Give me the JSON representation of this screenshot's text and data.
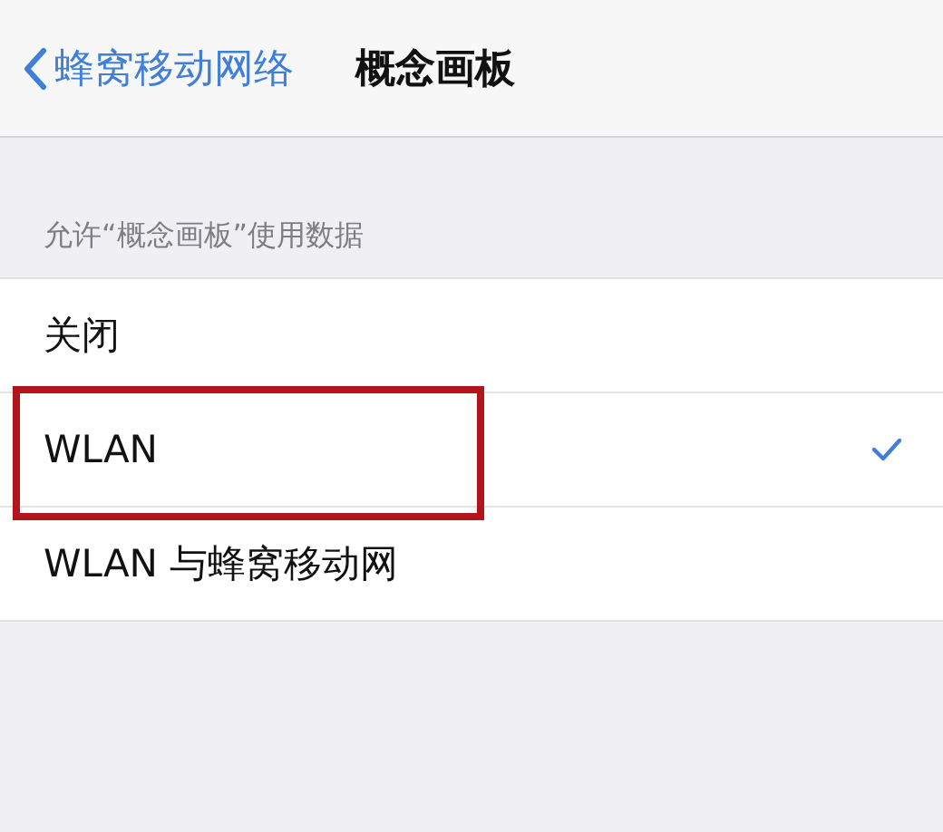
{
  "nav_bar": {
    "back_label": "蜂窝移动网络",
    "title": "概念画板"
  },
  "section": {
    "header": "允许“概念画板”使用数据",
    "options": [
      {
        "label": "关闭",
        "selected": false,
        "highlighted": false
      },
      {
        "label": "WLAN",
        "selected": true,
        "highlighted": true
      },
      {
        "label": "WLAN 与蜂窝移动网",
        "selected": false,
        "highlighted": false
      }
    ]
  }
}
